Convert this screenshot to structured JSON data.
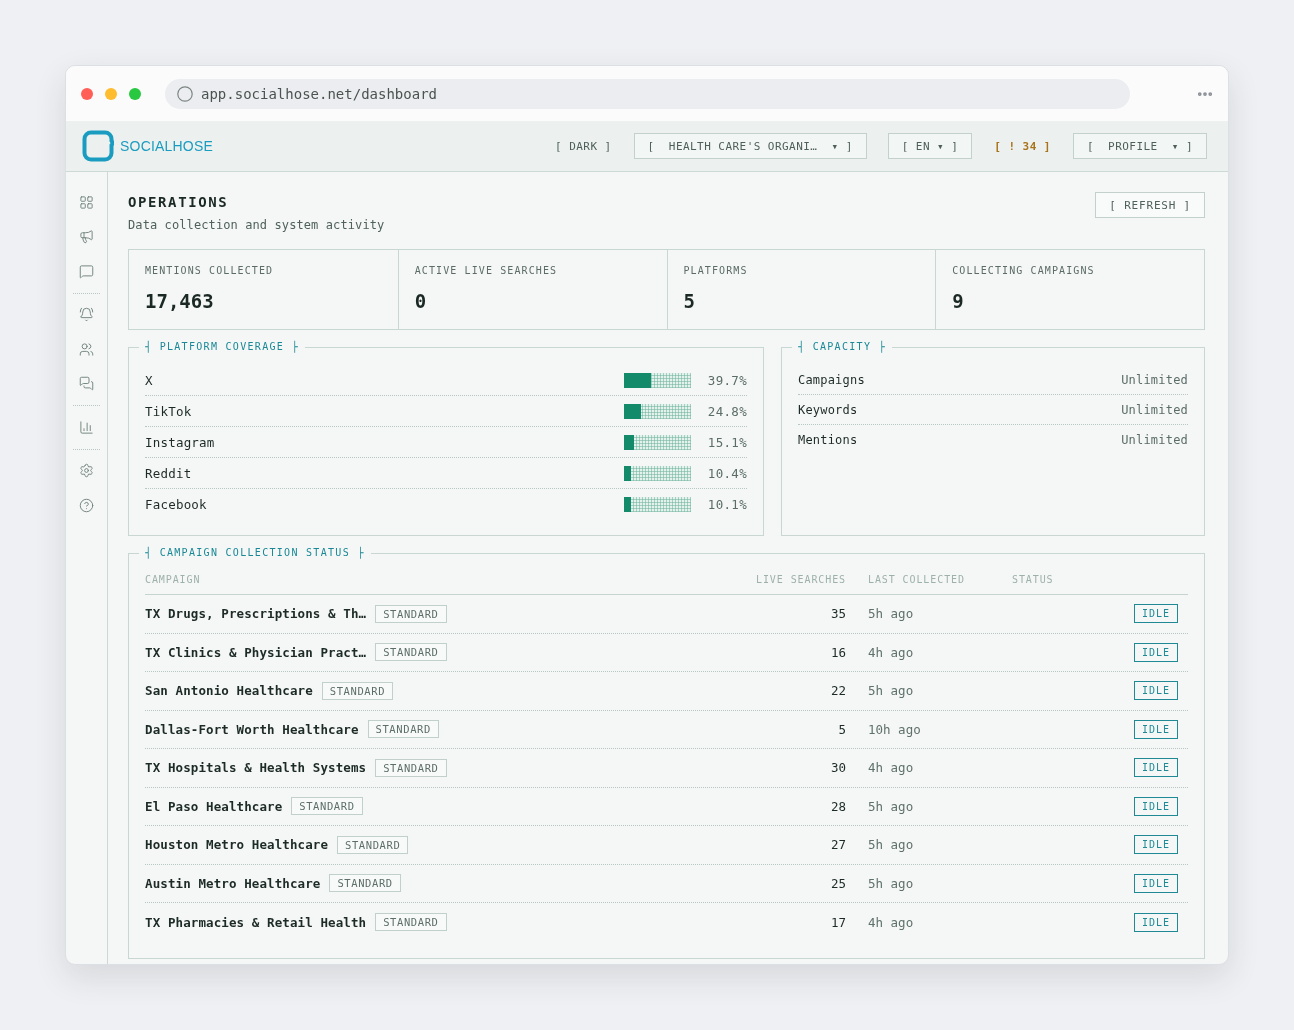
{
  "browser": {
    "url": "app.socialhose.net/dashboard"
  },
  "header": {
    "brand": "SOCIALHOSE",
    "controls": [
      {
        "kind": "text",
        "label": "[ DARK ]"
      },
      {
        "kind": "boxed",
        "label": "[  HEALTH CARE'S ORGANI…  ▾ ]"
      },
      {
        "kind": "boxed",
        "label": "[ EN ▾ ]"
      },
      {
        "kind": "alert",
        "label": "[ ! 34 ]"
      },
      {
        "kind": "boxed",
        "label": "[  PROFILE  ▾ ]"
      }
    ]
  },
  "page": {
    "title": "OPERATIONS",
    "subtitle": "Data collection and system activity",
    "refresh": "[ REFRESH ]"
  },
  "stats": [
    {
      "label": "MENTIONS COLLECTED",
      "value": "17,463"
    },
    {
      "label": "ACTIVE LIVE SEARCHES",
      "value": "0"
    },
    {
      "label": "PLATFORMS",
      "value": "5"
    },
    {
      "label": "COLLECTING CAMPAIGNS",
      "value": "9"
    }
  ],
  "platform_coverage": {
    "title": "┤ PLATFORM COVERAGE ├",
    "rows": [
      {
        "name": "X",
        "level": 0.397,
        "percent": "39.7%"
      },
      {
        "name": "TikTok",
        "level": 0.248,
        "percent": "24.8%"
      },
      {
        "name": "Instagram",
        "level": 0.151,
        "percent": "15.1%"
      },
      {
        "name": "Reddit",
        "level": 0.104,
        "percent": "10.4%"
      },
      {
        "name": "Facebook",
        "level": 0.101,
        "percent": "10.1%"
      }
    ]
  },
  "capacity": {
    "title": "┤ CAPACITY ├",
    "rows": [
      {
        "name": "Campaigns",
        "value": "Unlimited"
      },
      {
        "name": "Keywords",
        "value": "Unlimited"
      },
      {
        "name": "Mentions",
        "value": "Unlimited"
      }
    ]
  },
  "campaign_status": {
    "title": "┤ CAMPAIGN COLLECTION STATUS ├",
    "columns": [
      "CAMPAIGN",
      "LIVE SEARCHES",
      "LAST COLLECTED",
      "STATUS"
    ],
    "rows": [
      {
        "name": "TX Drugs, Prescriptions & Th…",
        "tier": "STANDARD",
        "live_searches": "35",
        "last_collected": "5h ago",
        "status": "IDLE"
      },
      {
        "name": "TX Clinics & Physician Pract…",
        "tier": "STANDARD",
        "live_searches": "16",
        "last_collected": "4h ago",
        "status": "IDLE"
      },
      {
        "name": "San Antonio Healthcare",
        "tier": "STANDARD",
        "live_searches": "22",
        "last_collected": "5h ago",
        "status": "IDLE"
      },
      {
        "name": "Dallas-Fort Worth Healthcare",
        "tier": "STANDARD",
        "live_searches": "5",
        "last_collected": "10h ago",
        "status": "IDLE"
      },
      {
        "name": "TX Hospitals & Health Systems",
        "tier": "STANDARD",
        "live_searches": "30",
        "last_collected": "4h ago",
        "status": "IDLE"
      },
      {
        "name": "El Paso Healthcare",
        "tier": "STANDARD",
        "live_searches": "28",
        "last_collected": "5h ago",
        "status": "IDLE"
      },
      {
        "name": "Houston Metro Healthcare",
        "tier": "STANDARD",
        "live_searches": "27",
        "last_collected": "5h ago",
        "status": "IDLE"
      },
      {
        "name": "Austin Metro Healthcare",
        "tier": "STANDARD",
        "live_searches": "25",
        "last_collected": "5h ago",
        "status": "IDLE"
      },
      {
        "name": "TX Pharmacies & Retail Health",
        "tier": "STANDARD",
        "live_searches": "17",
        "last_collected": "4h ago",
        "status": "IDLE"
      }
    ]
  }
}
